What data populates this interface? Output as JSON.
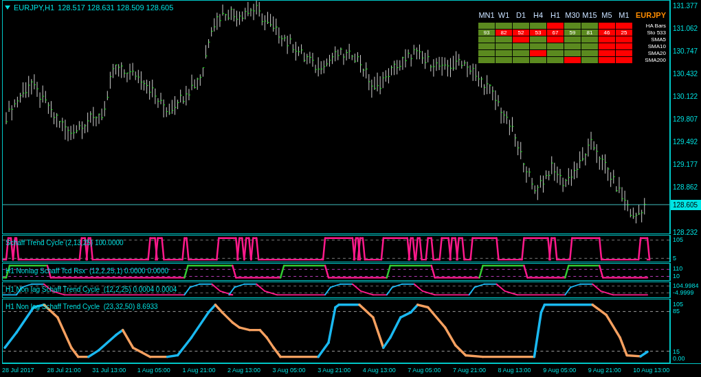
{
  "header": {
    "symbol": "EURJPY,H1",
    "ohlc": "128.517 128.631 128.509 128.605"
  },
  "dashboard": {
    "symbol": "EURJPY",
    "columns": [
      "MN1",
      "W1",
      "D1",
      "H4",
      "H1",
      "M30",
      "M15",
      "M5",
      "M1"
    ],
    "rows": [
      {
        "label": "HA Bars",
        "cells": [
          {
            "color": "#5b8a1f"
          },
          {
            "color": "#5b8a1f"
          },
          {
            "color": "#5b8a1f"
          },
          {
            "color": "#5b8a1f"
          },
          {
            "color": "#ff0000"
          },
          {
            "color": "#5b8a1f"
          },
          {
            "color": "#5b8a1f"
          },
          {
            "color": "#ff0000"
          },
          {
            "color": "#ff0000"
          }
        ]
      },
      {
        "label": "Sto 533",
        "cells": [
          {
            "color": "#5b8a1f",
            "text": "93"
          },
          {
            "color": "#ff0000",
            "text": "82"
          },
          {
            "color": "#ff0000",
            "text": "52"
          },
          {
            "color": "#ff0000",
            "text": "53"
          },
          {
            "color": "#ff0000",
            "text": "67"
          },
          {
            "color": "#5b8a1f",
            "text": "59"
          },
          {
            "color": "#5b8a1f",
            "text": "81"
          },
          {
            "color": "#ff0000",
            "text": "46"
          },
          {
            "color": "#ff0000",
            "text": "25"
          }
        ]
      },
      {
        "label": "SMA5",
        "cells": [
          {
            "color": "#5b8a1f"
          },
          {
            "color": "#5b8a1f"
          },
          {
            "color": "#ff0000"
          },
          {
            "color": "#5b8a1f"
          },
          {
            "color": "#ff0000"
          },
          {
            "color": "#5b8a1f"
          },
          {
            "color": "#5b8a1f"
          },
          {
            "color": "#ff0000"
          },
          {
            "color": "#ff0000"
          }
        ]
      },
      {
        "label": "SMA10",
        "cells": [
          {
            "color": "#5b8a1f"
          },
          {
            "color": "#5b8a1f"
          },
          {
            "color": "#5b8a1f"
          },
          {
            "color": "#5b8a1f"
          },
          {
            "color": "#5b8a1f"
          },
          {
            "color": "#5b8a1f"
          },
          {
            "color": "#5b8a1f"
          },
          {
            "color": "#ff0000"
          },
          {
            "color": "#ff0000"
          }
        ]
      },
      {
        "label": "SMA20",
        "cells": [
          {
            "color": "#5b8a1f"
          },
          {
            "color": "#5b8a1f"
          },
          {
            "color": "#5b8a1f"
          },
          {
            "color": "#ff0000"
          },
          {
            "color": "#5b8a1f"
          },
          {
            "color": "#5b8a1f"
          },
          {
            "color": "#5b8a1f"
          },
          {
            "color": "#ff0000"
          },
          {
            "color": "#ff0000"
          }
        ]
      },
      {
        "label": "SMA200",
        "cells": [
          {
            "color": "#5b8a1f"
          },
          {
            "color": "#5b8a1f"
          },
          {
            "color": "#5b8a1f"
          },
          {
            "color": "#5b8a1f"
          },
          {
            "color": "#5b8a1f"
          },
          {
            "color": "#ff0000"
          },
          {
            "color": "#5b8a1f"
          },
          {
            "color": "#ff0000"
          },
          {
            "color": "#ff0000"
          }
        ]
      }
    ]
  },
  "price_axis": {
    "ticks": [
      "131.377",
      "131.062",
      "130.747",
      "130.432",
      "130.122",
      "129.807",
      "129.492",
      "129.177",
      "128.862",
      "128.232"
    ],
    "current_price": "128.605"
  },
  "indicators": [
    {
      "kind": "square_wave",
      "title": "Schaff Trend Cycle (2,13,25) 100.0000",
      "axis_labels": [
        "105",
        "5"
      ]
    },
    {
      "kind": "two_tone_steps",
      "title": "H1 Nonlag Schaff Tcd Rsx  (12,2,25,1) 0.0000 0.0000",
      "axis_labels": [
        "110",
        "10"
      ]
    },
    {
      "kind": "rise_decay",
      "title": "H1 Non lag Schaff Trend Cycle  (12,2,25) 0.0004 0.0004",
      "axis_labels": [
        "104.9984",
        "-4.9999"
      ]
    },
    {
      "kind": "smooth_cycle",
      "title": "H1 Non lag Schaff Trend Cycle  (23,32,50) 8.6933",
      "axis_labels": [
        "105",
        "85",
        "15",
        "0.00"
      ]
    }
  ],
  "time_axis": [
    "28 Jul 2017",
    "28 Jul 21:00",
    "31 Jul 13:00",
    "1 Aug 05:00",
    "1 Aug 21:00",
    "2 Aug 13:00",
    "3 Aug 05:00",
    "3 Aug 21:00",
    "4 Aug 13:00",
    "7 Aug 05:00",
    "7 Aug 21:00",
    "8 Aug 13:00",
    "9 Aug 05:00",
    "9 Aug 21:00",
    "10 Aug 13:00"
  ]
}
